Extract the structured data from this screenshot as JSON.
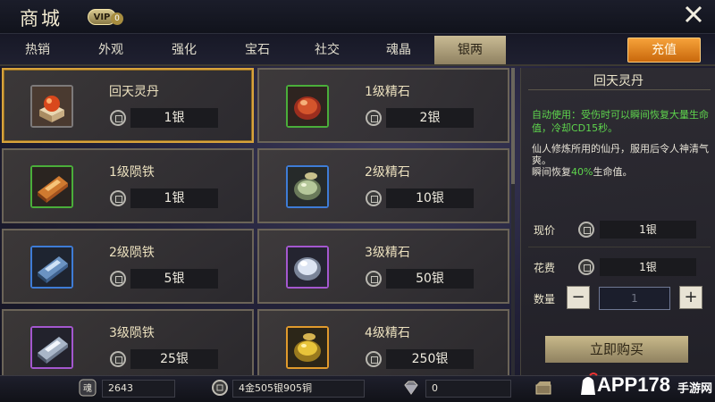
{
  "header": {
    "title": "商城",
    "vip_label": "VIP",
    "vip_level": "0"
  },
  "tabs": [
    {
      "label": "热销",
      "active": false
    },
    {
      "label": "外观",
      "active": false
    },
    {
      "label": "强化",
      "active": false
    },
    {
      "label": "宝石",
      "active": false
    },
    {
      "label": "社交",
      "active": false
    },
    {
      "label": "魂晶",
      "active": false
    },
    {
      "label": "银两",
      "active": true
    }
  ],
  "recharge_label": "充值",
  "items": [
    {
      "name": "回天灵丹",
      "price": "1银",
      "icon": "pill-icon",
      "grade": "gray",
      "selected": true
    },
    {
      "name": "1级精石",
      "price": "2银",
      "icon": "red-stone-icon",
      "grade": "green",
      "selected": false
    },
    {
      "name": "1级陨铁",
      "price": "1银",
      "icon": "copper-ingot-icon",
      "grade": "green",
      "selected": false
    },
    {
      "name": "2级精石",
      "price": "10银",
      "icon": "green-stone-icon",
      "grade": "blue",
      "selected": false
    },
    {
      "name": "2级陨铁",
      "price": "5银",
      "icon": "blue-ingot-icon",
      "grade": "blue",
      "selected": false
    },
    {
      "name": "3级精石",
      "price": "50银",
      "icon": "white-stone-icon",
      "grade": "purple",
      "selected": false
    },
    {
      "name": "3级陨铁",
      "price": "25银",
      "icon": "silver-ingot-icon",
      "grade": "purple",
      "selected": false
    },
    {
      "name": "4级精石",
      "price": "250银",
      "icon": "gold-stone-icon",
      "grade": "orange",
      "selected": false
    }
  ],
  "detail": {
    "title": "回天灵丹",
    "auto_use": "自动使用：受伤时可以瞬间恢复大量生命值，冷却CD15秒。",
    "desc_line1": "仙人修炼所用的仙丹，服用后令人神清气爽。",
    "desc_line2_prefix": "瞬间恢复",
    "desc_line2_pct": "40%",
    "desc_line2_suffix": "生命值。",
    "current_price_label": "现价",
    "current_price": "1银",
    "cost_label": "花费",
    "cost": "1银",
    "quantity_label": "数量",
    "quantity": "1",
    "minus_label": "−",
    "plus_label": "+",
    "buy_label": "立即购买"
  },
  "footer": {
    "soul": "2643",
    "money": "4金505银905铜",
    "diamond": "0"
  },
  "watermark": {
    "main": "APP178",
    "sub": "手游网"
  },
  "colors": {
    "accent_orange": "#e8821e",
    "active_tab": "#b9aa82",
    "green_text": "#5ed54d",
    "selected_border": "#d8a33c"
  }
}
